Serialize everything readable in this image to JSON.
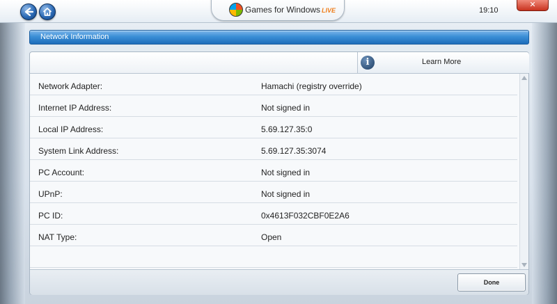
{
  "topbar": {
    "logo_text": "Games for Windows",
    "logo_suffix": "LIVE",
    "clock": "19:10",
    "close_label": "✕"
  },
  "header": {
    "title": "Network Information"
  },
  "learn_more": {
    "label": "Learn More",
    "icon_glyph": "i"
  },
  "rows": [
    {
      "key": "Network Adapter:",
      "value": "Hamachi (registry override)"
    },
    {
      "key": "Internet IP Address:",
      "value": "Not signed in"
    },
    {
      "key": "Local IP Address:",
      "value": "5.69.127.35:0"
    },
    {
      "key": "System Link Address:",
      "value": "5.69.127.35:3074"
    },
    {
      "key": "PC Account:",
      "value": "Not signed in"
    },
    {
      "key": "UPnP:",
      "value": "Not signed in"
    },
    {
      "key": "PC ID:",
      "value": "0x4613F032CBF0E2A6"
    },
    {
      "key": "NAT Type:",
      "value": "Open"
    },
    {
      "key": "",
      "value": ""
    }
  ],
  "footer": {
    "done_label": "Done"
  },
  "colors": {
    "header_blue": "#2d7cc6",
    "close_red": "#c8321e",
    "live_orange": "#ef7d1a"
  }
}
